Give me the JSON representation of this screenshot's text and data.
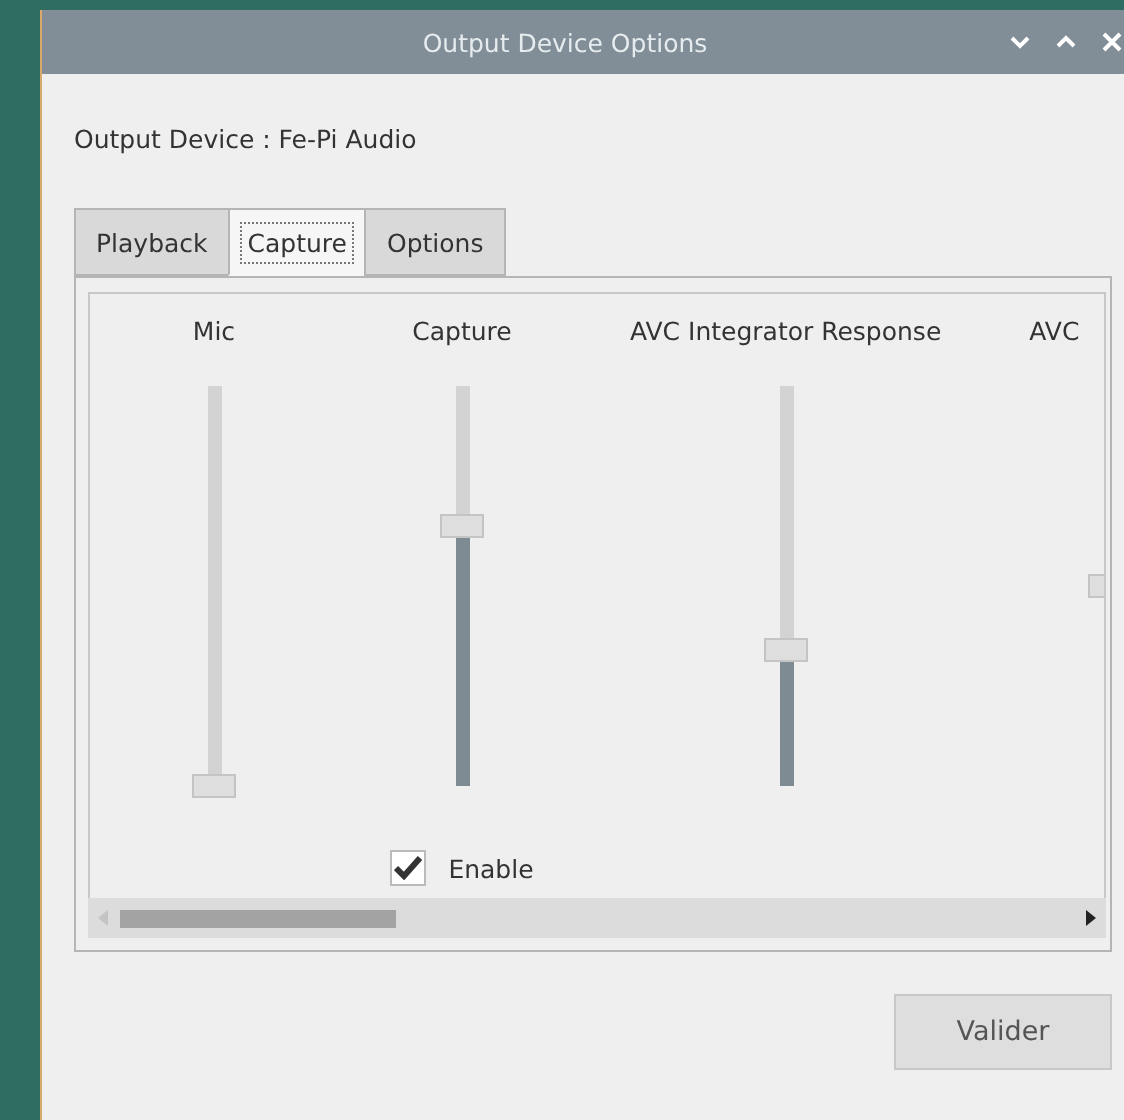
{
  "window": {
    "title": "Output Device Options"
  },
  "device_label": "Output Device : Fe-Pi Audio",
  "tabs": [
    {
      "label": "Playback",
      "selected": false
    },
    {
      "label": "Capture",
      "selected": true
    },
    {
      "label": "Options",
      "selected": false
    }
  ],
  "channels": [
    {
      "name": "Mic",
      "level": 0
    },
    {
      "name": "Capture",
      "level": 0.65,
      "switch": {
        "label": "Enable",
        "checked": true
      }
    },
    {
      "name": "AVC Integrator Response",
      "level": 0.34
    },
    {
      "name": "AVC",
      "level": 0.5
    }
  ],
  "buttons": [
    "Valider"
  ]
}
